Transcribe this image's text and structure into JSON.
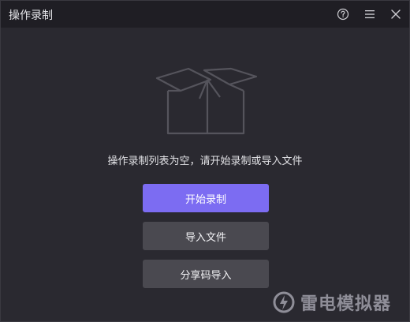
{
  "window": {
    "title": "操作录制"
  },
  "icons": {
    "help": "help-circle-icon",
    "menu": "hamburger-menu-icon",
    "close": "close-icon",
    "empty": "open-box-icon",
    "logo": "ldplayer-logo-icon"
  },
  "empty_state": {
    "message": "操作录制列表为空，请开始录制或导入文件"
  },
  "actions": {
    "start_label": "开始录制",
    "import_label": "导入文件",
    "share_import_label": "分享码导入"
  },
  "watermark": {
    "text": "雷电模拟器"
  },
  "colors": {
    "primary_button": "#7c6cf2",
    "secondary_button": "#4a4950",
    "titlebar": "#1f1e24",
    "background": "#2a2930"
  }
}
